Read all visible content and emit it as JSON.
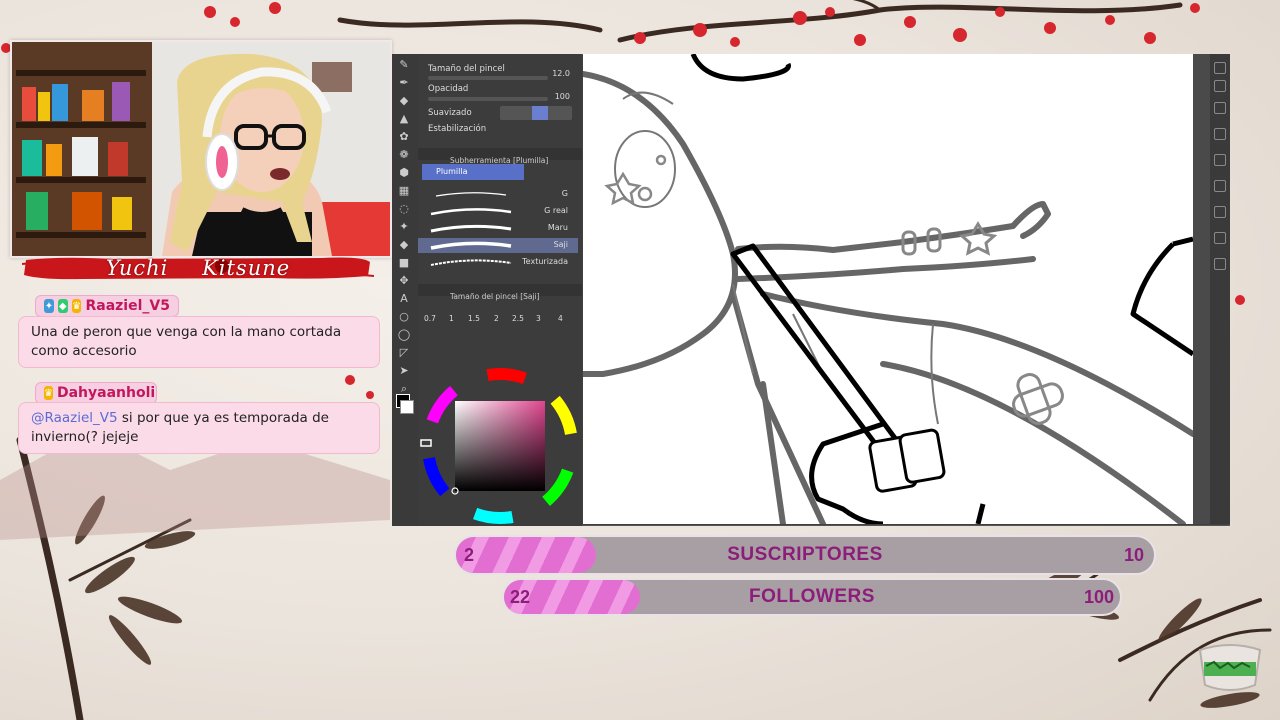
{
  "streamer": {
    "name_first": "Yuchi",
    "name_last": "Kitsune"
  },
  "chat": [
    {
      "user": "Raaziel_V5",
      "badges": [
        "moderator-icon",
        "vip-icon",
        "crown-icon"
      ],
      "message": "Una de peron que venga con la mano cortada como accesorio",
      "mention": ""
    },
    {
      "user": "Dahyaanholi",
      "badges": [
        "crown-icon"
      ],
      "mention": "@Raaziel_V5",
      "message": " si por que ya es temporada de invierno(? jejeje"
    }
  ],
  "app": {
    "tool_properties": {
      "brush_size_label": "Tamaño del pincel",
      "brush_size_value": "12.0",
      "opacity_label": "Opacidad",
      "opacity_value": "100",
      "smoothing_label": "Suavizado",
      "stabilization_label": "Estabilización"
    },
    "subtool_header": "Subherramienta [Plumilla]",
    "subtool_group": "Plumilla",
    "brushes": [
      "G",
      "G real",
      "Maru",
      "Saji",
      "Texturizada"
    ],
    "selected_brush_index": 3,
    "brush_size_header": "Tamaño del pincel [Saji]",
    "brush_sizes": [
      "0.7",
      "1",
      "1.5",
      "2",
      "2.5",
      "3",
      "4"
    ],
    "color_accent": "#e0458f"
  },
  "goals": {
    "subs": {
      "label": "SUSCRIPTORES",
      "current": "2",
      "target": "10",
      "progress_fraction": 0.2
    },
    "followers": {
      "label": "FOLLOWERS",
      "current": "22",
      "target": "100",
      "progress_fraction": 0.22
    }
  },
  "colors": {
    "bar_fill": "#e36ed2",
    "bar_text": "#8c1d7a",
    "chat_bg": "#fbdbe8",
    "banner": "#c9161b"
  }
}
